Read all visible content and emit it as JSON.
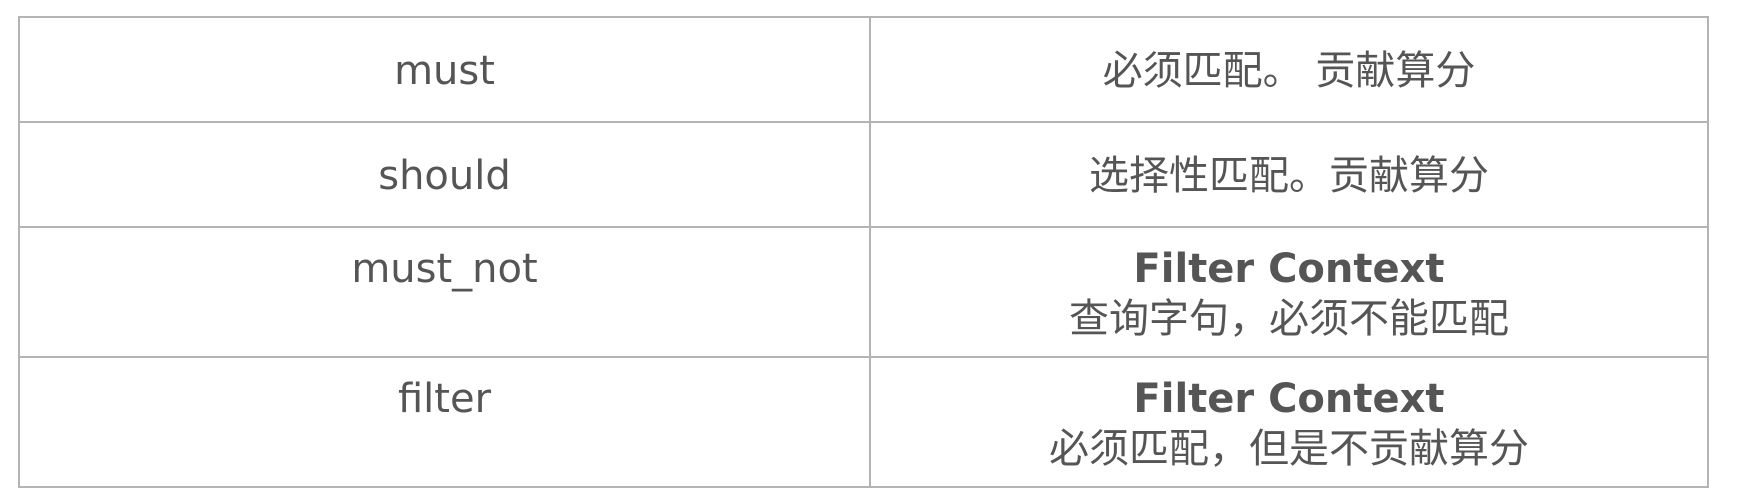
{
  "table": {
    "rows": [
      {
        "clause": "must",
        "description": "必须匹配。 贡献算分"
      },
      {
        "clause": "should",
        "description": "选择性匹配。贡献算分"
      },
      {
        "clause": "must_not",
        "description_title": "Filter Context",
        "description": "查询字句，必须不能匹配"
      },
      {
        "clause": "filter",
        "description_title": "Filter Context",
        "description": "必须匹配，但是不贡献算分"
      }
    ]
  }
}
